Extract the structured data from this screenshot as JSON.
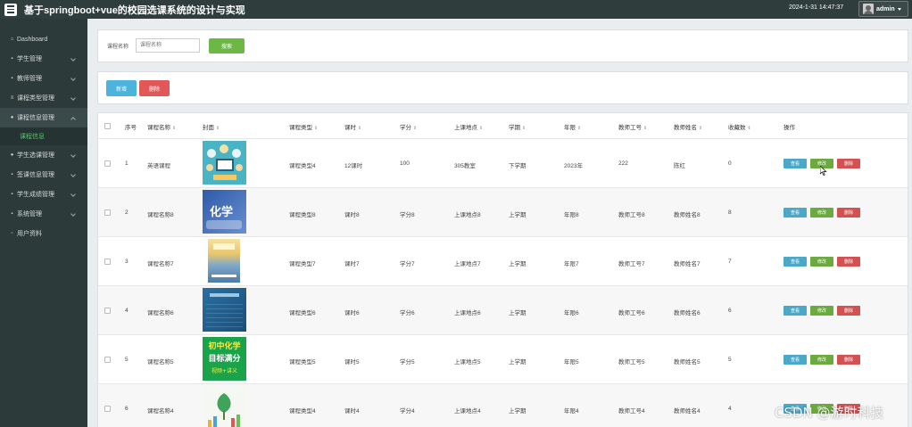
{
  "header": {
    "title": "基于springboot+vue的校园选课系统的设计与实现",
    "datetime": "2024-1-31 14:47:37",
    "username": "admin"
  },
  "sidebar": {
    "items": [
      {
        "label": "Dashboard",
        "icon": "home-icon"
      },
      {
        "label": "学生管理",
        "icon": "grid-icon"
      },
      {
        "label": "教师管理",
        "icon": "folder-icon"
      },
      {
        "label": "课程类型管理",
        "icon": "list-icon"
      },
      {
        "label": "课程信息管理",
        "icon": "user-icon",
        "open": true,
        "sub": [
          "课程信息"
        ]
      },
      {
        "label": "学生选课管理",
        "icon": "user-icon"
      },
      {
        "label": "签课信息管理",
        "icon": "book-icon"
      },
      {
        "label": "学生成绩管理",
        "icon": "grid-icon"
      },
      {
        "label": "系统管理",
        "icon": "grid-icon"
      },
      {
        "label": "用户资料",
        "icon": "doc-icon"
      }
    ]
  },
  "search": {
    "label": "课程名称",
    "placeholder": "课程名称",
    "button": "搜索"
  },
  "actions": {
    "add": "新增",
    "delete": "删除"
  },
  "table": {
    "headers": [
      "序号",
      "课程名称",
      "封面",
      "课程类型",
      "课时",
      "学分",
      "上课地点",
      "学期",
      "年限",
      "教师工号",
      "教师姓名",
      "收藏数",
      "操作"
    ],
    "row_actions": {
      "view": "查看",
      "edit": "修改",
      "delete": "删除"
    },
    "rows": [
      {
        "index": "1",
        "name": "英语课程",
        "type": "课程类型4",
        "hours": "12课时",
        "credit": "100",
        "location": "305教室",
        "term": "下学期",
        "year": "2023年",
        "teacher_id": "222",
        "teacher_name": "陈红",
        "favorites": "0",
        "cover": "book-cover"
      },
      {
        "index": "2",
        "name": "课程名称8",
        "type": "课程类型8",
        "hours": "课时8",
        "credit": "学分8",
        "location": "上课地点8",
        "term": "上学期",
        "year": "年限8",
        "teacher_id": "教师工号8",
        "teacher_name": "教师姓名8",
        "favorites": "8",
        "cover": "chemistry-cover",
        "cover_text": "化学"
      },
      {
        "index": "3",
        "name": "课程名称7",
        "type": "课程类型7",
        "hours": "课时7",
        "credit": "学分7",
        "location": "上课地点7",
        "term": "上学期",
        "year": "年限7",
        "teacher_id": "教师工号7",
        "teacher_name": "教师姓名7",
        "favorites": "7",
        "cover": "textbook-cover"
      },
      {
        "index": "4",
        "name": "课程名称6",
        "type": "课程类型6",
        "hours": "课时6",
        "credit": "学分6",
        "location": "上课地点6",
        "term": "上学期",
        "year": "年限6",
        "teacher_id": "教师工号6",
        "teacher_name": "教师姓名6",
        "favorites": "6",
        "cover": "blue-cover"
      },
      {
        "index": "5",
        "name": "课程名称5",
        "type": "课程类型5",
        "hours": "课时5",
        "credit": "学分5",
        "location": "上课地点5",
        "term": "上学期",
        "year": "年限5",
        "teacher_id": "教师工号5",
        "teacher_name": "教师姓名5",
        "favorites": "5",
        "cover": "green-cover",
        "cover_lines": [
          "初中化学",
          "目标满分",
          "视频+讲义"
        ]
      },
      {
        "index": "6",
        "name": "课程名称4",
        "type": "课程类型4",
        "hours": "课时4",
        "credit": "学分4",
        "location": "上课地点4",
        "term": "上学期",
        "year": "年限4",
        "teacher_id": "教师工号4",
        "teacher_name": "教师姓名4",
        "favorites": "4",
        "cover": "plant-cover"
      }
    ]
  },
  "watermark": "CSDN @游时科技",
  "colors": {
    "header_bg": "#2f3e3d",
    "sidebar_bg": "#2d3a3a",
    "active_sub": "#55c46b",
    "search_btn": "#6bb845",
    "add_btn": "#4bb3dc",
    "delete_btn": "#e25757",
    "view_btn": "#4ba8c8",
    "edit_btn": "#6aaa3e",
    "row_delete_btn": "#d55050"
  }
}
